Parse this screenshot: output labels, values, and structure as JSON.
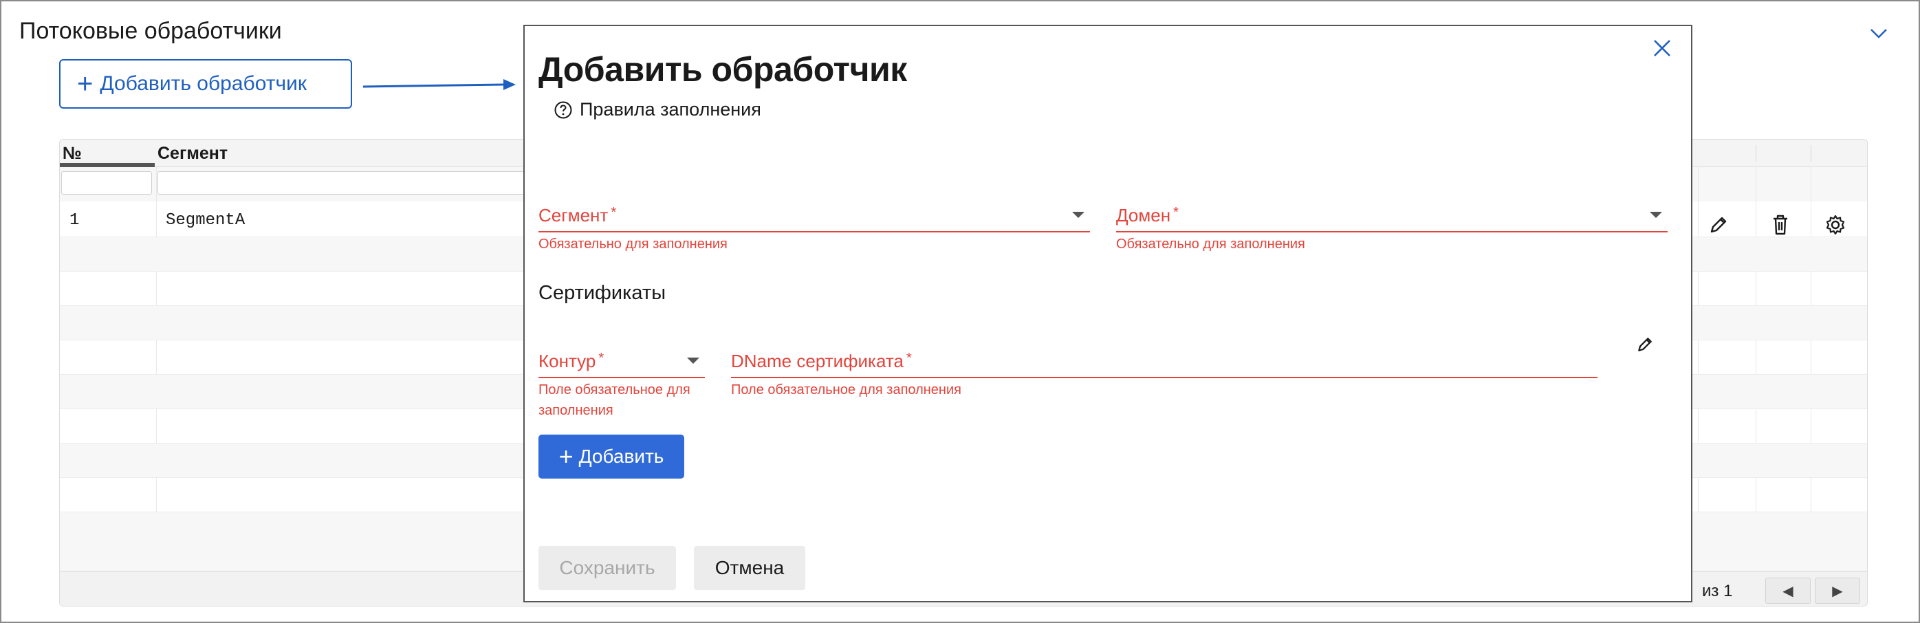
{
  "page": {
    "title": "Потоковые обработчики",
    "add_button_label": "Добавить обработчик"
  },
  "table": {
    "columns": [
      "№",
      "Сегмент"
    ],
    "rows": [
      {
        "no": "1",
        "segment": "SegmentA"
      }
    ],
    "pager": {
      "of_label": "из 1",
      "prev": "◀",
      "next": "▶"
    }
  },
  "modal": {
    "title": "Добавить обработчик",
    "rules_link": "Правила заполнения",
    "fields": {
      "segment": {
        "label": "Сегмент",
        "required_mark": "*",
        "error": "Обязательно для заполнения"
      },
      "domain": {
        "label": "Домен",
        "required_mark": "*",
        "error": "Обязательно для заполнения"
      }
    },
    "certificates": {
      "section_title": "Сертификаты",
      "contour": {
        "label": "Контур",
        "required_mark": "*",
        "error_line1": "Поле обязательное для",
        "error_line2": "заполнения"
      },
      "dname": {
        "label": "DName сертификата",
        "required_mark": "*",
        "error": "Поле обязательное для заполнения"
      },
      "add_label": "Добавить"
    },
    "save_label": "Сохранить",
    "cancel_label": "Отмена"
  },
  "colors": {
    "accent": "#2f6ad8",
    "link_blue": "#1f5fbf",
    "error": "#e2453c",
    "disabled_text": "#a8a8a8"
  }
}
